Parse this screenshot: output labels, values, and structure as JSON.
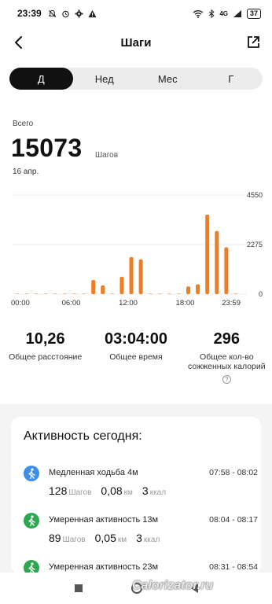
{
  "status_bar": {
    "time": "23:39",
    "network": "4G",
    "battery": "37",
    "icons": [
      "muted-bell-icon",
      "alarm-icon",
      "gear-icon",
      "warning-icon",
      "wifi-icon",
      "bluetooth-icon",
      "signal-icon"
    ]
  },
  "header": {
    "title": "Шаги",
    "back_icon": "chevron-left-icon",
    "share_icon": "share-icon"
  },
  "tabs": [
    {
      "label": "Д",
      "active": true
    },
    {
      "label": "Нед",
      "active": false
    },
    {
      "label": "Мес",
      "active": false
    },
    {
      "label": "Г",
      "active": false
    }
  ],
  "summary": {
    "total_label": "Всего",
    "total_value": "15073",
    "total_unit": "Шагов",
    "date": "16 апр."
  },
  "chart_data": {
    "type": "bar",
    "x_tick_labels": [
      "00:00",
      "06:00",
      "12:00",
      "18:00",
      "23:59"
    ],
    "y_tick_labels": [
      "4550",
      "2275",
      "0"
    ],
    "ylim": [
      0,
      4550
    ],
    "bar_color": "#f07d22",
    "points": [
      {
        "hour": 8.5,
        "value": 650
      },
      {
        "hour": 9.5,
        "value": 400
      },
      {
        "hour": 11.5,
        "value": 800
      },
      {
        "hour": 12.5,
        "value": 1700
      },
      {
        "hour": 13.5,
        "value": 1600
      },
      {
        "hour": 18.5,
        "value": 350
      },
      {
        "hour": 19.5,
        "value": 450
      },
      {
        "hour": 20.5,
        "value": 3650
      },
      {
        "hour": 21.5,
        "value": 2900
      },
      {
        "hour": 22.5,
        "value": 2150
      }
    ]
  },
  "stats": [
    {
      "value": "10,26",
      "label": "Общее расстояние"
    },
    {
      "value": "03:04:00",
      "label": "Общее время"
    },
    {
      "value": "296",
      "label": "Общее кол-во сожженных калорий"
    }
  ],
  "activity": {
    "title": "Активность сегодня:",
    "items": [
      {
        "name": "Медленная ходьба 4м",
        "time": "07:58 - 08:02",
        "icon": "walking-icon",
        "color": "#3d8ee8",
        "steps": "128",
        "steps_unit": "Шагов",
        "distance": "0,08",
        "distance_unit": "км",
        "kcal": "3",
        "kcal_unit": "ккал"
      },
      {
        "name": "Умеренная активность 13м",
        "time": "08:04 - 08:17",
        "icon": "walking-icon",
        "color": "#2ea84f",
        "steps": "89",
        "steps_unit": "Шагов",
        "distance": "0,05",
        "distance_unit": "км",
        "kcal": "3",
        "kcal_unit": "ккал"
      },
      {
        "name": "Умеренная активность 23м",
        "time": "08:31 - 08:54",
        "icon": "walking-icon",
        "color": "#2ea84f"
      }
    ]
  },
  "watermark": "Calorizator.ru"
}
